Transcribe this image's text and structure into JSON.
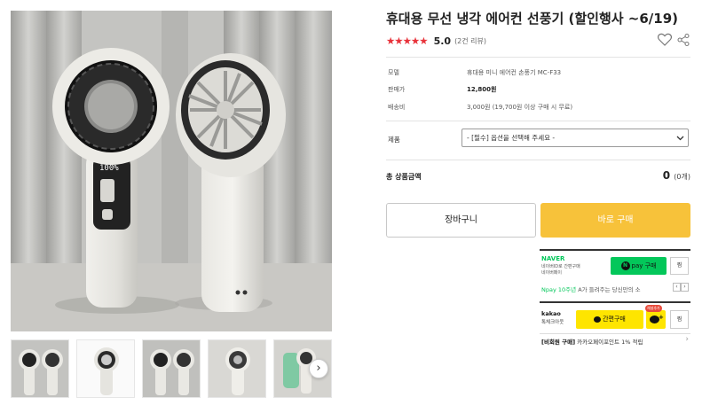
{
  "product": {
    "title": "휴대용 무선 냉각 에어컨 선풍기 (할인행사 ~6/19)",
    "stars": "★★★★★",
    "score": "5.0",
    "review_count": "(2건 리뷰)"
  },
  "specs": [
    {
      "label": "모델",
      "value": "휴대용 미니 에어컨 손풍기 MC-F33"
    },
    {
      "label": "판매가",
      "value": "12,800원"
    },
    {
      "label": "배송비",
      "value": "3,000원 (19,700원 이상 구매 시 무료)"
    }
  ],
  "option": {
    "label": "제품",
    "select_value": "- [필수] 옵션을 선택해 주세요 -"
  },
  "total": {
    "label": "총 상품금액",
    "amount": "0",
    "count": "(0개)"
  },
  "buttons": {
    "cart": "장바구니",
    "buy": "바로 구매"
  },
  "naver": {
    "logo": "NAVER",
    "sub_line1": "네이버ID로 간편구매",
    "sub_line2": "네이버페이",
    "pay_n": "N",
    "pay_label": "pay 구매",
    "wish": "찜",
    "promo_green": "Npay 10주년",
    "promo_gray": " A가 들려주는 당신만의 소",
    "prev": "‹",
    "next": "›"
  },
  "kakao": {
    "logo": "kakao",
    "sub": "톡체크아웃",
    "buy_label": "간편구매",
    "badge": "채널추가",
    "wish": "찜"
  },
  "guest": {
    "bold": "[비회원 구매]",
    "text": " 카카오페이포인트 1% 적립"
  },
  "gallery": {
    "thumb_count": 5,
    "next_arrow": "›",
    "display_readout": "100%"
  },
  "icons": {
    "heart": "heart-icon",
    "share": "share-icon",
    "select_chevron": "chevron-down-icon"
  },
  "colors": {
    "star": "#e8333b",
    "buy_button": "#f7c23a",
    "naver_green": "#03c75a",
    "kakao_yellow": "#fee500"
  }
}
